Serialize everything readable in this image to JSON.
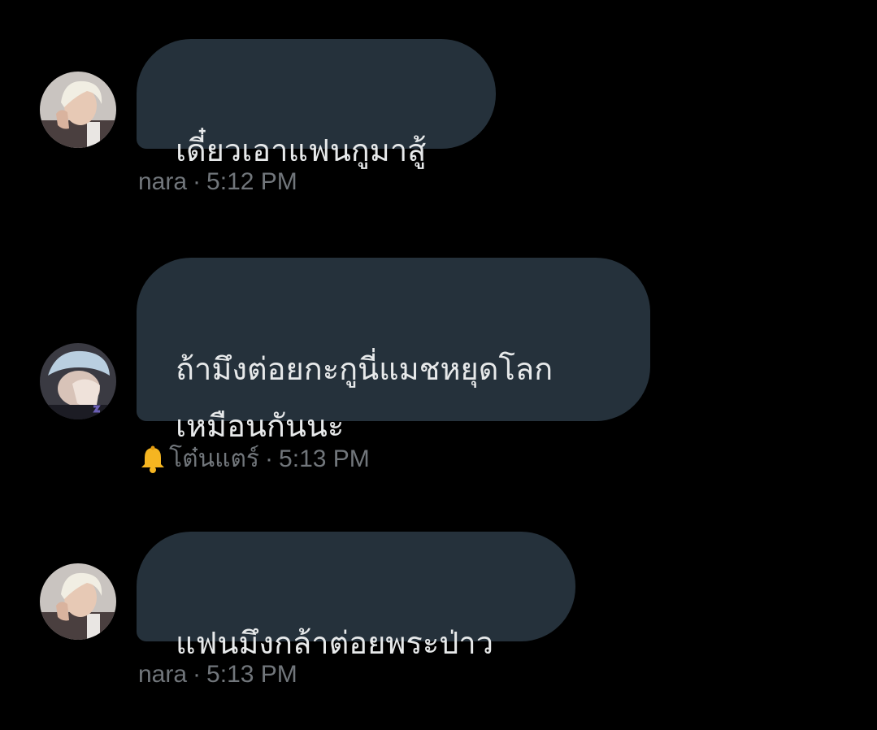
{
  "messages": [
    {
      "text": "เดี๋ยวเอาแฟนกูมาสู้",
      "sender": "nara",
      "separator": "·",
      "time": "5:12 PM",
      "avatar_icon": "user-avatar-blonde"
    },
    {
      "text": "ถ้ามึงต่อยกะกูนี่แมชหยุดโลก\nเหมือนกันนะ",
      "sender_emoji_icon": "bell-icon",
      "sender": "โต๋นแตร์",
      "separator": "·",
      "time": "5:13 PM",
      "avatar_icon": "user-avatar-cap"
    },
    {
      "text": "แฟนมึงกล้าต่อยพระป่าว",
      "sender": "nara",
      "separator": "·",
      "time": "5:13 PM",
      "avatar_icon": "user-avatar-blonde"
    }
  ],
  "colors": {
    "background": "#000000",
    "bubble": "#25313b",
    "text": "#e7e9ea",
    "meta": "#71767b"
  }
}
